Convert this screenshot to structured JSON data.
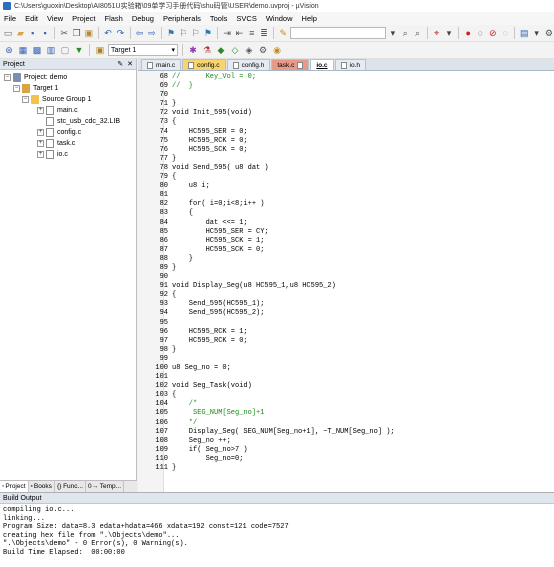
{
  "window": {
    "title": "C:\\Users\\guoxin\\Desktop\\AI8051U实验箱\\09单学习手册代码\\shu码管\\USER\\demo.uvproj - µVision"
  },
  "menu": [
    "File",
    "Edit",
    "View",
    "Project",
    "Flash",
    "Debug",
    "Peripherals",
    "Tools",
    "SVCS",
    "Window",
    "Help"
  ],
  "toolbar": {
    "target_name": "Target 1"
  },
  "project_panel": {
    "title": "Project",
    "tree": [
      {
        "label": "Project: demo",
        "expander": "−",
        "icon": "project-icon"
      },
      {
        "label": "Target 1",
        "expander": "−",
        "icon": "target-icon"
      },
      {
        "label": "Source Group 1",
        "expander": "−",
        "icon": "folder-icon"
      },
      {
        "label": "main.c",
        "expander": "+",
        "icon": "file-icon"
      },
      {
        "label": "stc_usb_cdc_32.LIB",
        "expander": "",
        "icon": "lib-icon"
      },
      {
        "label": "config.c",
        "expander": "+",
        "icon": "file-icon"
      },
      {
        "label": "task.c",
        "expander": "+",
        "icon": "file-icon"
      },
      {
        "label": "io.c",
        "expander": "+",
        "icon": "file-icon"
      }
    ],
    "tabs": [
      "Project",
      "Books",
      "{} Func...",
      "0→ Temp..."
    ]
  },
  "editor": {
    "tabs": [
      {
        "label": "main.c",
        "color": "#e6ebf1"
      },
      {
        "label": "config.c",
        "color": "#f7d46e"
      },
      {
        "label": "config.h",
        "color": "#e6ebf1"
      },
      {
        "label": "task.c",
        "color": "#e99a86"
      },
      {
        "label": "io.c",
        "color": "#ffffff",
        "active": true
      },
      {
        "label": "io.h",
        "color": "#e6ebf1"
      }
    ],
    "lines": [
      {
        "n": "68",
        "text": "//      Key_Vol = 0;",
        "kind": "comment"
      },
      {
        "n": "69",
        "text": "//  }",
        "kind": "comment"
      },
      {
        "n": "70",
        "text": "",
        "kind": "code"
      },
      {
        "n": "71",
        "text": "}",
        "kind": "code"
      },
      {
        "n": "72",
        "text": "void Init_595(void)",
        "kind": "code"
      },
      {
        "n": "73",
        "text": "{",
        "kind": "code"
      },
      {
        "n": "74",
        "text": "    HC595_SER = 0;",
        "kind": "code"
      },
      {
        "n": "75",
        "text": "    HC595_RCK = 0;",
        "kind": "code"
      },
      {
        "n": "76",
        "text": "    HC595_SCK = 0;",
        "kind": "code"
      },
      {
        "n": "77",
        "text": "}",
        "kind": "code"
      },
      {
        "n": "78",
        "text": "void Send_595( u8 dat )",
        "kind": "code"
      },
      {
        "n": "79",
        "text": "{",
        "kind": "code"
      },
      {
        "n": "80",
        "text": "    u8 i;",
        "kind": "code"
      },
      {
        "n": "81",
        "text": "",
        "kind": "code"
      },
      {
        "n": "82",
        "text": "    for( i=0;i<8;i++ )",
        "kind": "code"
      },
      {
        "n": "83",
        "text": "    {",
        "kind": "code"
      },
      {
        "n": "84",
        "text": "        dat <<= 1;",
        "kind": "code"
      },
      {
        "n": "85",
        "text": "        HC595_SER = CY;",
        "kind": "code"
      },
      {
        "n": "86",
        "text": "        HC595_SCK = 1;",
        "kind": "code"
      },
      {
        "n": "87",
        "text": "        HC595_SCK = 0;",
        "kind": "code"
      },
      {
        "n": "88",
        "text": "    }",
        "kind": "code"
      },
      {
        "n": "89",
        "text": "}",
        "kind": "code"
      },
      {
        "n": "90",
        "text": "",
        "kind": "code"
      },
      {
        "n": "91",
        "text": "void Display_Seg(u8 HC595_1,u8 HC595_2)",
        "kind": "code"
      },
      {
        "n": "92",
        "text": "{",
        "kind": "code"
      },
      {
        "n": "93",
        "text": "    Send_595(HC595_1);",
        "kind": "code"
      },
      {
        "n": "94",
        "text": "    Send_595(HC595_2);",
        "kind": "code"
      },
      {
        "n": "95",
        "text": "",
        "kind": "code"
      },
      {
        "n": "96",
        "text": "    HC595_RCK = 1;",
        "kind": "code"
      },
      {
        "n": "97",
        "text": "    HC595_RCK = 0;",
        "kind": "code"
      },
      {
        "n": "98",
        "text": "}",
        "kind": "code"
      },
      {
        "n": "99",
        "text": "",
        "kind": "code"
      },
      {
        "n": "100",
        "text": "u8 Seg_no = 0;",
        "kind": "code"
      },
      {
        "n": "101",
        "text": "",
        "kind": "code"
      },
      {
        "n": "102",
        "text": "void Seg_Task(void)",
        "kind": "code"
      },
      {
        "n": "103",
        "text": "{",
        "kind": "code"
      },
      {
        "n": "104",
        "text": "    /*",
        "kind": "comment"
      },
      {
        "n": "105",
        "text": "     SEG_NUM[Seg_no]+1",
        "kind": "comment"
      },
      {
        "n": "106",
        "text": "    */",
        "kind": "comment"
      },
      {
        "n": "107",
        "text": "    Display_Seg( SEG_NUM[Seg_no+1], ~T_NUM[Seg_no] );",
        "kind": "code"
      },
      {
        "n": "108",
        "text": "    Seg_no ++;",
        "kind": "code"
      },
      {
        "n": "109",
        "text": "    if( Seg_no>7 )",
        "kind": "code"
      },
      {
        "n": "110",
        "text": "        Seg_no=0;",
        "kind": "code"
      },
      {
        "n": "111",
        "text": "}",
        "kind": "code"
      }
    ]
  },
  "build_output": {
    "title": "Build Output",
    "lines": [
      "compiling io.c...",
      "linking...",
      "Program Size: data=8.3 edata+hdata=466 xdata=192 const=121 code=7527",
      "creating hex file from \".\\Objects\\demo\"...",
      "\".\\Objects\\demo\" - 0 Error(s), 0 Warning(s).",
      "Build Time Elapsed:  00:00:00"
    ]
  }
}
